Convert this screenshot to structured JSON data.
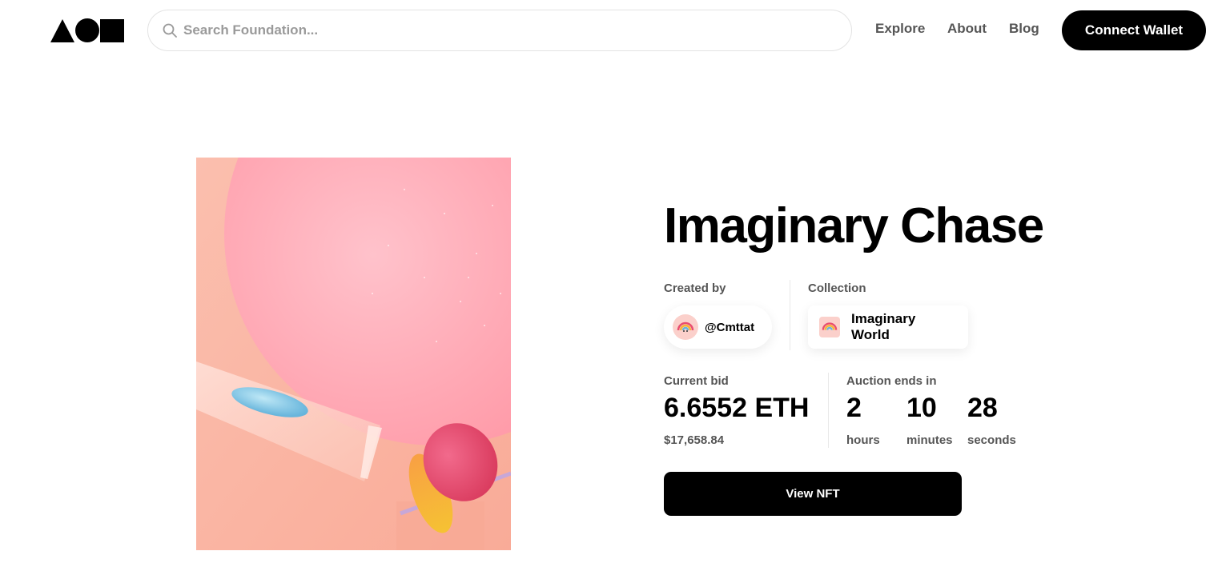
{
  "header": {
    "logo_icon": "foundation-shapes-logo",
    "search_placeholder": "Search Foundation...",
    "nav": {
      "explore": "Explore",
      "about": "About",
      "blog": "Blog"
    },
    "connect_label": "Connect Wallet"
  },
  "artwork": {
    "palette": {
      "background": "#f9b6a2",
      "sphere": "#ff9aa8",
      "capsule": "#e94d6f",
      "accent": "#f7b437",
      "droplet": "#7ec8e8"
    }
  },
  "nft": {
    "title": "Imaginary Chase",
    "created_by_label": "Created by",
    "creator_handle": "@Cmttat",
    "collection_label": "Collection",
    "collection_name": "Imaginary World",
    "current_bid_label": "Current bid",
    "current_bid": "6.6552 ETH",
    "current_bid_usd": "$17,658.84",
    "auction_label": "Auction ends in",
    "countdown": {
      "hours": "2",
      "hours_label": "hours",
      "minutes": "10",
      "minutes_label": "minutes",
      "seconds": "28",
      "seconds_label": "seconds"
    },
    "view_label": "View NFT"
  },
  "colors": {
    "primary": "#000000",
    "muted_text": "#555555"
  }
}
